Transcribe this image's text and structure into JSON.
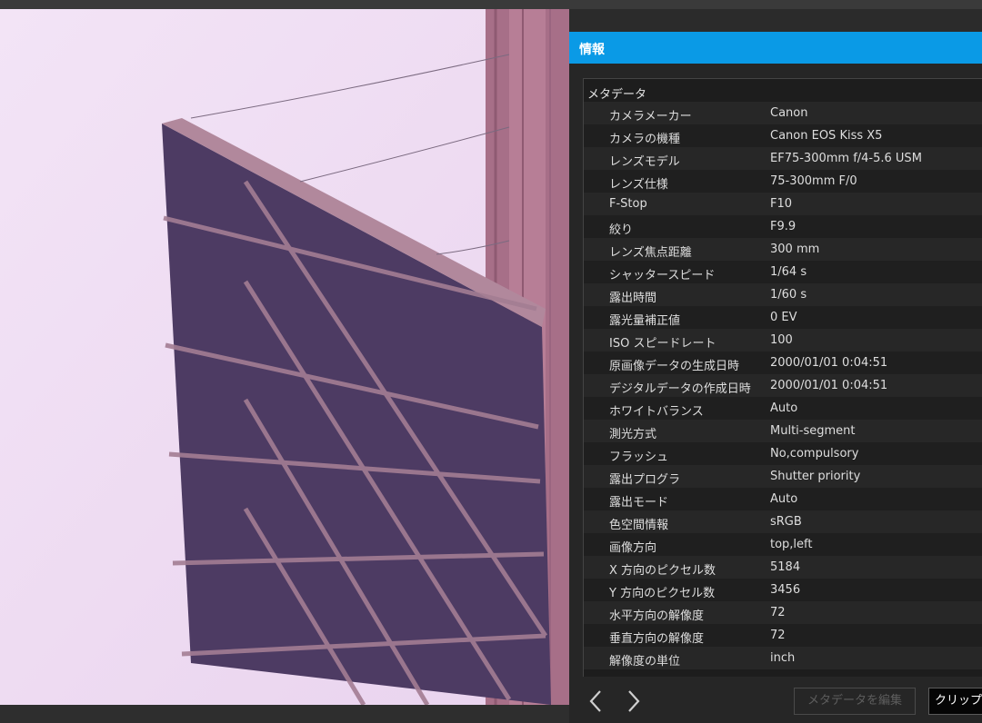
{
  "panel": {
    "title": "情報",
    "section_title": "メタデータ",
    "rows": [
      {
        "label": "カメラメーカー",
        "value": "Canon"
      },
      {
        "label": "カメラの機種",
        "value": "Canon EOS Kiss X5"
      },
      {
        "label": "レンズモデル",
        "value": "EF75-300mm f/4-5.6 USM"
      },
      {
        "label": "レンズ仕様",
        "value": "75-300mm F/0"
      },
      {
        "label": "F-Stop",
        "value": "F10"
      },
      {
        "label": "絞り",
        "value": "F9.9"
      },
      {
        "label": "レンズ焦点距離",
        "value": "300 mm"
      },
      {
        "label": "シャッタースピード",
        "value": "1/64 s"
      },
      {
        "label": "露出時間",
        "value": "1/60 s"
      },
      {
        "label": "露光量補正値",
        "value": "0 EV"
      },
      {
        "label": "ISO スピードレート",
        "value": "100"
      },
      {
        "label": "原画像データの生成日時",
        "value": "2000/01/01 0:04:51"
      },
      {
        "label": "デジタルデータの作成日時",
        "value": "2000/01/01 0:04:51"
      },
      {
        "label": "ホワイトバランス",
        "value": "Auto"
      },
      {
        "label": "測光方式",
        "value": "Multi-segment"
      },
      {
        "label": "フラッシュ",
        "value": "No,compulsory"
      },
      {
        "label": "露出プログラ",
        "value": "Shutter priority"
      },
      {
        "label": "露出モード",
        "value": "Auto"
      },
      {
        "label": "色空間情報",
        "value": "sRGB"
      },
      {
        "label": "画像方向",
        "value": "top,left"
      },
      {
        "label": "X 方向のピクセル数",
        "value": "5184"
      },
      {
        "label": "Y 方向のピクセル数",
        "value": "3456"
      },
      {
        "label": "水平方向の解像度",
        "value": "72"
      },
      {
        "label": "垂直方向の解像度",
        "value": "72"
      },
      {
        "label": "解像度の単位",
        "value": "inch"
      }
    ],
    "buttons": {
      "edit_metadata": "メタデータを編集",
      "clipboard": "クリップ"
    }
  },
  "icons": {
    "previous": "chevron-left-icon",
    "next": "chevron-right-icon"
  },
  "colors": {
    "title_bar": "#0a9ae6",
    "panel_bg": "#262626",
    "table_bg": "#1d1d1d"
  }
}
